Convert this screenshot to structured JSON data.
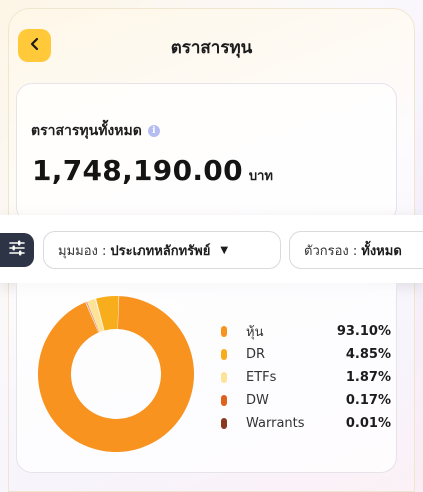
{
  "header": {
    "title": "ตราสารทุน"
  },
  "summary": {
    "label": "ตราสารทุนทั้งหมด",
    "amount": "1,748,190.00",
    "unit": "บาท"
  },
  "filters": {
    "view_label": "มุมมอง :",
    "view_value": "ประเภทหลักทรัพย์",
    "filter_label": "ตัวกรอง :",
    "filter_value": "ทั้งหมด"
  },
  "allocation": [
    {
      "name": "หุ้น",
      "percent": "93.10%",
      "value": 93.1,
      "color": "#f7931e"
    },
    {
      "name": "DR",
      "percent": "4.85%",
      "value": 4.85,
      "color": "#f8ad1c"
    },
    {
      "name": "ETFs",
      "percent": "1.87%",
      "value": 1.87,
      "color": "#fde39a"
    },
    {
      "name": "DW",
      "percent": "0.17%",
      "value": 0.17,
      "color": "#e0601e"
    },
    {
      "name": "Warrants",
      "percent": "0.01%",
      "value": 0.01,
      "color": "#8a3a1c"
    }
  ],
  "icons": {
    "back": "chevron-left-icon",
    "info": "info-icon",
    "filter": "sliders-icon",
    "dropdown": "caret-down-icon"
  },
  "colors": {
    "accent": "#ffc93a",
    "filter_button": "#2c3445"
  }
}
